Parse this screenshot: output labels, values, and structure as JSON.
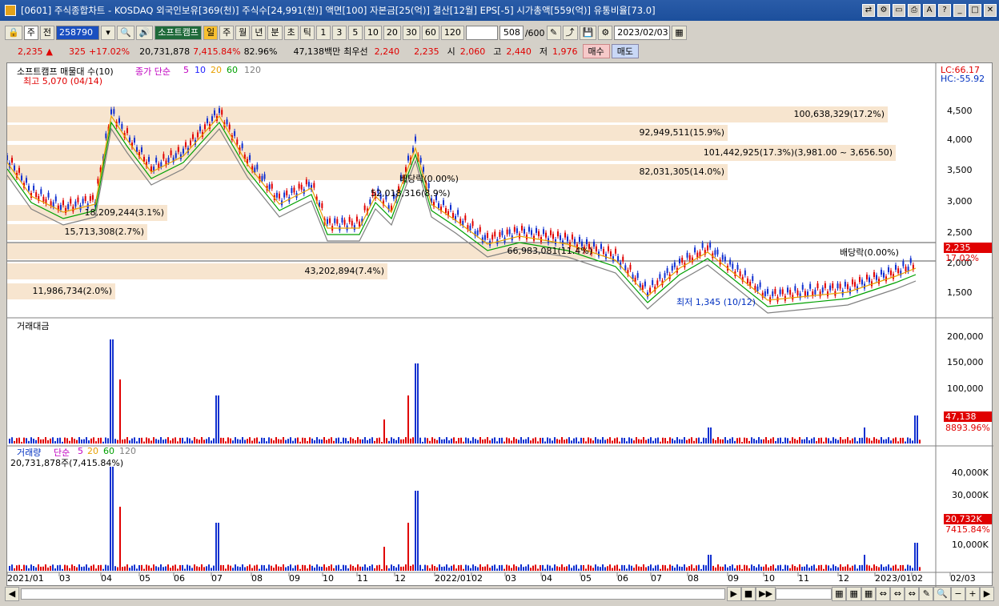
{
  "window": {
    "title": "[0601] 주식종합차트 - KOSDAQ 외국인보유[369(천)] 주식수[24,991(천)] 액면[100] 자본금[25(억)] 결산[12월] EPS[-5] 시가총액[559(억)] 유통비율[73.0]"
  },
  "toolbar": {
    "mode": "주",
    "prev": "전",
    "code": "258790",
    "stock_name": "소프트캠프",
    "periods": [
      "일",
      "주",
      "월",
      "년",
      "분",
      "초",
      "틱"
    ],
    "intervals": [
      "1",
      "3",
      "5",
      "10",
      "20",
      "30",
      "60",
      "120"
    ],
    "count": "508",
    "count_total": "/600",
    "date": "2023/02/03"
  },
  "quote": {
    "price": "2,235",
    "change": "325",
    "pct": "+17.02%",
    "volume": "20,731,878",
    "vol_ratio": "7,415.84%",
    "turn": "82.96%",
    "amount": "47,138백만",
    "best_label": "최우선",
    "best_ask": "2,240",
    "best_bid": "2,235",
    "open_label": "시",
    "open": "2,060",
    "high_label": "고",
    "high": "2,440",
    "low_label": "저",
    "low": "1,976",
    "buy": "매수",
    "sell": "매도"
  },
  "price_panel": {
    "legend_stock": "소프트캠프 매물대 수(10)",
    "ma_label": "종가 단순",
    "ma_periods": [
      "5",
      "10",
      "20",
      "60",
      "120"
    ],
    "lc": "LC:66.17",
    "hc": "HC:-55.92",
    "high_mark": "최고 5,070 (04/14)",
    "low_mark": "최저 1,345 (10/12)",
    "dividend1": "배당락(0.00%)",
    "dividend2": "배당락(0.00%)",
    "overlap_text": "52,018,316(8.9%)",
    "bands": [
      {
        "label": "100,638,329(17.2%)",
        "y": 142
      },
      {
        "label": "92,949,511(15.9%)",
        "y": 165
      },
      {
        "label": "101,442,925(17.3%)(3,981.00 ~ 3,656.50)",
        "y": 190
      },
      {
        "label": "82,031,305(14.0%)",
        "y": 214
      },
      {
        "label": "18,209,244(3.1%)",
        "y": 265
      },
      {
        "label": "15,713,308(2.7%)",
        "y": 289
      },
      {
        "label": "66,983,081(11.4%)",
        "y": 313
      },
      {
        "label": "43,202,894(7.4%)",
        "y": 338
      },
      {
        "label": "11,986,734(2.0%)",
        "y": 363
      }
    ],
    "yticks": [
      "4,500",
      "4,000",
      "3,500",
      "3,000",
      "2,500",
      "2,000",
      "1,500"
    ],
    "price_badge": "2,235",
    "pct_badge": "17.02%"
  },
  "amount_panel": {
    "title": "거래대금",
    "yticks": [
      "200,000",
      "150,000",
      "100,000",
      "50,000"
    ],
    "badge": "47,138",
    "badge2": "8893.96%"
  },
  "volume_panel": {
    "title": "거래량",
    "ma_label": "단순",
    "ma_periods": [
      "5",
      "20",
      "60",
      "120"
    ],
    "current": "20,731,878주(7,415.84%)",
    "yticks": [
      "40,000K",
      "30,000K",
      "20,000K",
      "10,000K"
    ],
    "badge": "20,732K",
    "badge2": "7415.84%"
  },
  "xaxis": [
    "2021/01",
    "03",
    "04",
    "05",
    "06",
    "07",
    "08",
    "09",
    "10",
    "11",
    "12",
    "2022/01",
    "02",
    "03",
    "04",
    "05",
    "06",
    "07",
    "08",
    "09",
    "10",
    "11",
    "12",
    "2023/01",
    "02",
    "02/03"
  ],
  "colors": {
    "up": "#e00000",
    "down": "#1030d0",
    "ma5": "#c000c0",
    "ma10": "#2020ff",
    "ma20": "#e8a000",
    "ma60": "#00a000",
    "ma120": "#808080"
  }
}
